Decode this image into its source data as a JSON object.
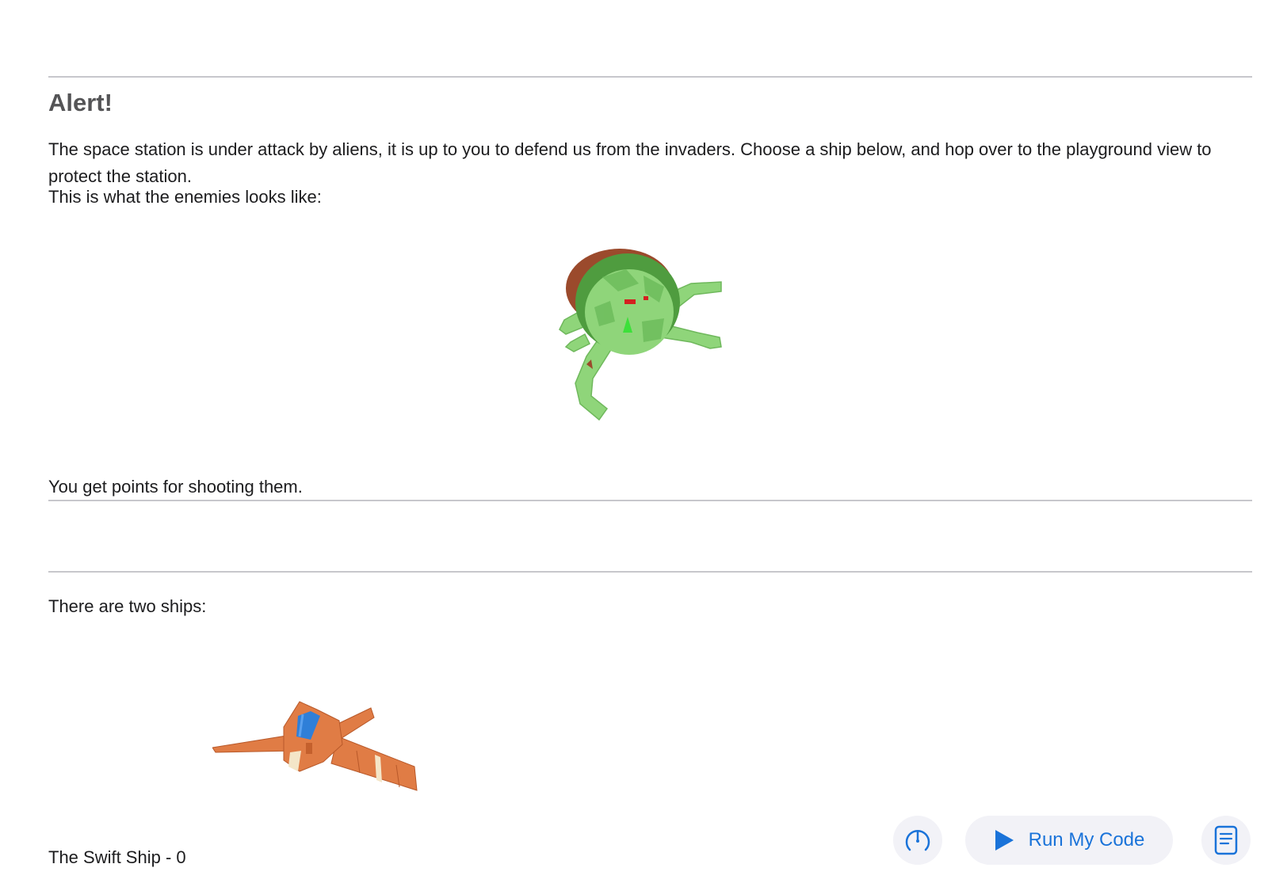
{
  "content": {
    "heading": "Alert!",
    "intro": "The space station is under attack by aliens, it is up to you to defend us from the invaders. Choose a ship below, and hop over to the playground view to protect the station.",
    "enemies_label": "This is what the enemies looks like:",
    "points_text": "You get points for shooting them.",
    "ships_label": "There are two ships:",
    "ship_name": "The Swift Ship - 0"
  },
  "toolbar": {
    "run_label": "Run My Code",
    "speed_icon": "speedometer-icon",
    "run_icon": "play-icon",
    "doc_icon": "document-icon"
  },
  "colors": {
    "accent": "#1a73d9",
    "alien_green": "#8fd57a",
    "ship_orange": "#e07c45"
  }
}
